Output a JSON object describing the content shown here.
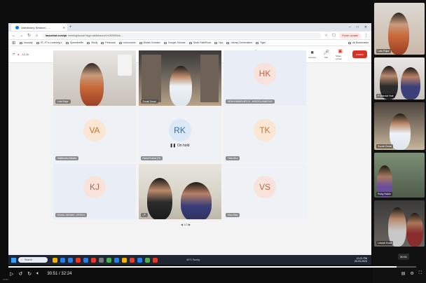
{
  "browser": {
    "tab_title": "Valedictory Session - ...",
    "url_host": "lazsoriwd.com/qb",
    "url_rest": "meeting/launch?sign=addbbarzzz1%2f2b0f4cb...",
    "profile_label": "Finish update",
    "bookmarks": [
      "Inoxudy",
      "IIT-JTI e-Learning L",
      "Speedforfile",
      "Study",
      "Personal",
      "Uniconnect",
      "Mobile Number",
      "Google Scholar",
      "Shah Patil/Rock",
      "Nyz",
      "Library Universities",
      "Tiger"
    ],
    "bookmarks_last": "All Bookmarks"
  },
  "meeting": {
    "duration": "12:11",
    "tools": [
      {
        "label": "Chat",
        "icon": "chat-icon"
      },
      {
        "label": "People",
        "icon": "people-icon"
      },
      {
        "label": "Raise",
        "icon": "raise-hand-icon"
      },
      {
        "label": "React",
        "icon": "react-icon"
      },
      {
        "label": "View",
        "icon": "view-icon"
      },
      {
        "label": "More",
        "icon": "more-icon"
      },
      {
        "label": "Camera",
        "icon": "camera-icon"
      },
      {
        "label": "Mic",
        "icon": "mic-icon"
      },
      {
        "label": "Share screen",
        "icon": "share-icon"
      }
    ],
    "leave_label": "Leave",
    "page_indicator": "◀ 1/2 ▶"
  },
  "participants": [
    {
      "type": "video",
      "name": "Lata Rajur"
    },
    {
      "type": "video",
      "name": "Sonali Desai"
    },
    {
      "type": "avatar",
      "initials": "HK",
      "name": "HEM KUMARI-BTCS - MISCELLANEOUS",
      "color": "#c87a5e"
    },
    {
      "type": "avatar",
      "initials": "VA",
      "name": "Vallamadu Akkala",
      "color": "#c4782e"
    },
    {
      "type": "avatar",
      "initials": "RK",
      "name": "Rahul Kumar (R)",
      "color": "#3a6fa0",
      "status": "On hold"
    },
    {
      "type": "avatar",
      "initials": "TK",
      "name": "Tanu Kiru",
      "color": "#c4782e"
    },
    {
      "type": "avatar",
      "initials": "KJ",
      "name": "KAJAL JADHAV - BTECH",
      "color": "#c87a5e"
    },
    {
      "type": "video",
      "name": ""
    },
    {
      "type": "avatar",
      "initials": "VS",
      "name": "Vinu Sha",
      "color": "#c87a5e"
    }
  ],
  "side_participants": [
    {
      "name": "Lata Rajur"
    },
    {
      "name": "P Mandal Nair"
    },
    {
      "name": "Sonali Desai"
    },
    {
      "name": "Ruby Naidu"
    },
    {
      "name": "Lilavati Bose"
    }
  ],
  "taskbar": {
    "search_placeholder": "Search",
    "weather": "30°C Sunny",
    "clock_time": "10:21 PM",
    "clock_date": "25-03-2024"
  },
  "player": {
    "current_time": "30:51",
    "total_time": "32:24",
    "time_display": "30:51 / 32:24",
    "progress": 0.952,
    "tooltip": "30:51",
    "brand": "zoom"
  }
}
